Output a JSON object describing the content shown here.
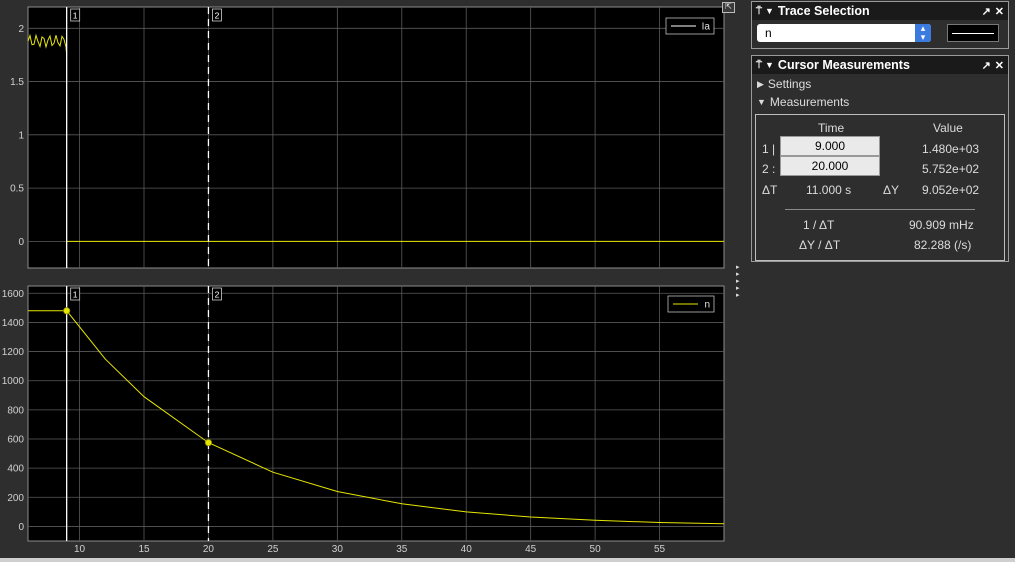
{
  "top_plot": {
    "legend": "Ia",
    "y_ticks": [
      "2",
      "1.5",
      "1",
      "0.5",
      "0"
    ],
    "y_range": [
      -0.25,
      2.2
    ],
    "cursor_labels": [
      "1",
      "2"
    ]
  },
  "bottom_plot": {
    "legend": "n",
    "y_ticks": [
      "1600",
      "1400",
      "1200",
      "1000",
      "800",
      "600",
      "400",
      "200",
      "0"
    ],
    "y_range": [
      -100,
      1650
    ],
    "cursor_labels": [
      "1",
      "2"
    ]
  },
  "x_axis": {
    "ticks": [
      "10",
      "15",
      "20",
      "25",
      "30",
      "35",
      "40",
      "45",
      "50",
      "55"
    ],
    "range": [
      6.0,
      60.0
    ]
  },
  "trace_selection": {
    "title": "Trace Selection",
    "selected": "n"
  },
  "cursor_measurements": {
    "title": "Cursor Measurements",
    "settings_label": "Settings",
    "measurements_label": "Measurements",
    "col_time": "Time",
    "col_value": "Value",
    "row1_label": "1 |",
    "row2_label": "2 :",
    "cursor1_time": "9.000",
    "cursor2_time": "20.000",
    "cursor1_value": "1.480e+03",
    "cursor2_value": "5.752e+02",
    "dt_label": "ΔT",
    "dt_value": "11.000 s",
    "dy_label": "ΔY",
    "dy_value": "9.052e+02",
    "inv_dt_label": "1 / ΔT",
    "inv_dt_value": "90.909 mHz",
    "slope_label": "ΔY / ΔT",
    "slope_value": "82.288 (/s)"
  },
  "chart_data": [
    {
      "type": "line",
      "series": [
        {
          "name": "Ia",
          "x": [
            6.0,
            9.0,
            9.0,
            60.0
          ],
          "y": [
            1.9,
            1.9,
            0.0,
            0.0
          ]
        }
      ],
      "xlim": [
        6.0,
        60.0
      ],
      "ylim": [
        -0.25,
        2.2
      ],
      "cursors_x": [
        9.0,
        20.0
      ],
      "legend_position": "top-right",
      "grid": true
    },
    {
      "type": "line",
      "series": [
        {
          "name": "n",
          "x": [
            6.0,
            9.0,
            12,
            15,
            20,
            25,
            30,
            35,
            40,
            45,
            50,
            55,
            60
          ],
          "y": [
            1480,
            1480,
            1148,
            890,
            575,
            372,
            240,
            155,
            100,
            65,
            42,
            27,
            18
          ]
        }
      ],
      "xlim": [
        6.0,
        60.0
      ],
      "ylim": [
        -100,
        1650
      ],
      "cursors_x": [
        9.0,
        20.0
      ],
      "legend_position": "top-right",
      "grid": true
    }
  ],
  "colors": {
    "trace": "#e6e600",
    "plot_bg": "#000000",
    "grid": "#5a5a5a",
    "axis_text": "#d0d0d0"
  }
}
